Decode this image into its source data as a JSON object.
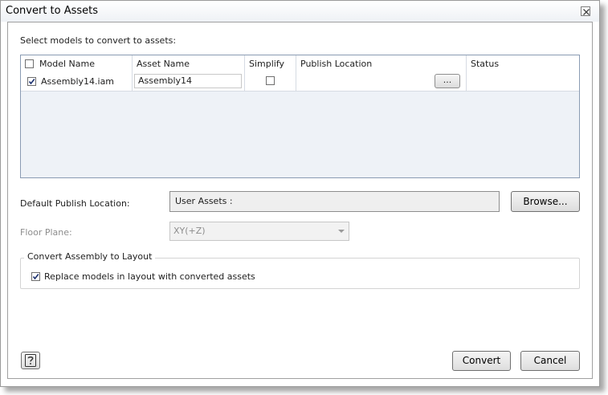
{
  "window": {
    "title": "Convert to Assets"
  },
  "models": {
    "label": "Select models to convert to assets:",
    "columns": {
      "model_name": "Model Name",
      "asset_name": "Asset Name",
      "simplify": "Simplify",
      "publish_location": "Publish Location",
      "status": "Status"
    },
    "select_all_checked": false,
    "rows": [
      {
        "checked": true,
        "model_name": "Assembly14.iam",
        "asset_name": "Assembly14",
        "simplify": false,
        "publish_location": "",
        "browse_label": "...",
        "status": ""
      }
    ]
  },
  "default_publish": {
    "label": "Default Publish Location:",
    "value": "User Assets :",
    "browse_label": "Browse..."
  },
  "floor_plane": {
    "label": "Floor Plane:",
    "value": "XY(+Z)",
    "enabled": false
  },
  "convert_assembly": {
    "group_title": "Convert Assembly to Layout",
    "replace_label": "Replace models in layout with converted assets",
    "replace_checked": true
  },
  "footer": {
    "help_icon": "help-question-icon",
    "convert_label": "Convert",
    "cancel_label": "Cancel"
  },
  "colors": {
    "grid_border": "#8a9bb3",
    "grid_background": "#eef2f7",
    "disabled_text": "#8d8d8d"
  }
}
